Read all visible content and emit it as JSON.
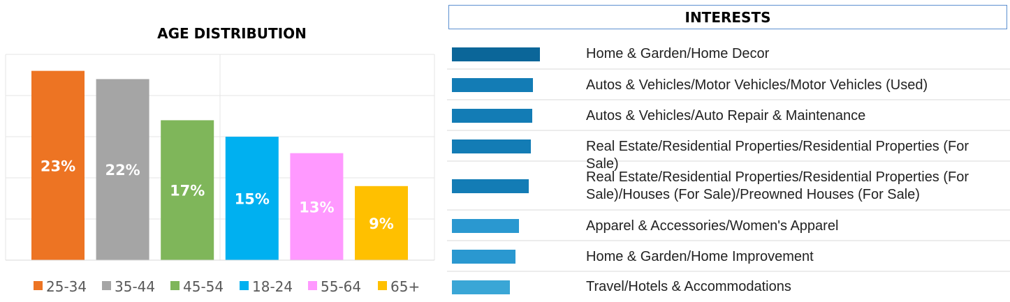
{
  "chart_data": [
    {
      "type": "bar",
      "title": "AGE DISTRIBUTION",
      "categories": [
        "25-34",
        "35-44",
        "45-54",
        "18-24",
        "55-64",
        "65+"
      ],
      "values": [
        23,
        22,
        17,
        15,
        13,
        9
      ],
      "value_labels": [
        "23%",
        "22%",
        "17%",
        "15%",
        "13%",
        "9%"
      ],
      "colors": [
        "#ed7423",
        "#a5a5a5",
        "#7fb65a",
        "#00b0f0",
        "#ff99ff",
        "#ffc000"
      ],
      "ylim": [
        0,
        25
      ],
      "grid": true,
      "legend": "bottom"
    },
    {
      "type": "bar",
      "orientation": "horizontal",
      "title": "INTERESTS",
      "categories": [
        "Home & Garden/Home Decor",
        "Autos & Vehicles/Motor Vehicles/Motor Vehicles (Used)",
        "Autos & Vehicles/Auto Repair & Maintenance",
        "Real Estate/Residential Properties/Residential Properties (For Sale)",
        "Real Estate/Residential Properties/Residential Properties (For Sale)/Houses (For Sale)/Preowned Houses (For Sale)",
        "Apparel & Accessories/Women's Apparel",
        "Home & Garden/Home Improvement",
        "Travel/Hotels & Accommodations"
      ],
      "values": [
        1.0,
        0.92,
        0.91,
        0.9,
        0.87,
        0.76,
        0.72,
        0.66
      ],
      "colors": [
        "#0b6699",
        "#137cb5",
        "#137cb5",
        "#137cb5",
        "#137cb5",
        "#2a98d0",
        "#2a98d0",
        "#3aa6d6"
      ]
    }
  ]
}
